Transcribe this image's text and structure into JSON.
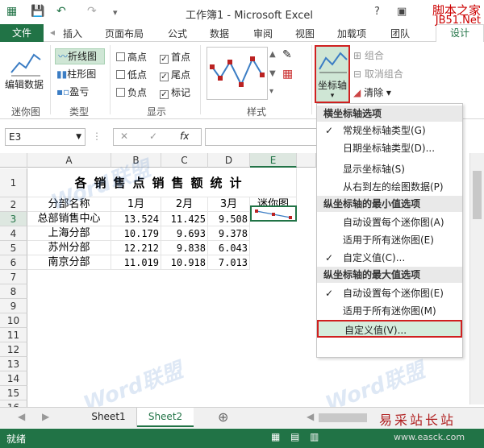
{
  "titlebar": {
    "title": "工作簿1 - Microsoft Excel",
    "help": "?",
    "brand_top": "脚本之家",
    "brand_bottom": "JB51.Net"
  },
  "tabs": [
    "插入",
    "页面布局",
    "公式",
    "数据",
    "审阅",
    "视图",
    "加载项",
    "团队"
  ],
  "file_tab": "文件",
  "design_tab": "设计",
  "ribbon": {
    "sparkline_group": {
      "edit_label": "编辑数据",
      "group_label": "迷你图"
    },
    "type_group": {
      "line": "折线图",
      "column": "柱形图",
      "winloss": "盈亏",
      "group_label": "类型"
    },
    "show_group": {
      "high": "高点",
      "first": "首点",
      "low": "低点",
      "last": "尾点",
      "negative": "负点",
      "markers": "标记",
      "high_checked": false,
      "first_checked": true,
      "low_checked": false,
      "last_checked": true,
      "negative_checked": false,
      "markers_checked": true,
      "group_label": "显示"
    },
    "style_group": {
      "group_label": "样式"
    },
    "axis_button": "坐标轴",
    "group_btn": "组合",
    "ungroup_btn": "取消组合",
    "clear_btn": "清除"
  },
  "formula": {
    "namebox": "E3",
    "fx": "fx"
  },
  "columns": [
    "A",
    "B",
    "C",
    "D",
    "E"
  ],
  "rows": [
    "1",
    "2",
    "3",
    "4",
    "5",
    "6",
    "7",
    "8",
    "9",
    "10",
    "11",
    "12",
    "13",
    "14",
    "15",
    "16"
  ],
  "sheet": {
    "title": "各销售点销售额统计",
    "headers": [
      "分部名称",
      "1月",
      "2月",
      "3月",
      "迷你图"
    ],
    "data": [
      {
        "name": "总部销售中心",
        "m1": "13.524",
        "m2": "11.425",
        "m3": "9.508"
      },
      {
        "name": "上海分部",
        "m1": "10.179",
        "m2": "9.693",
        "m3": "9.378"
      },
      {
        "name": "苏州分部",
        "m1": "12.212",
        "m2": "9.838",
        "m3": "6.043"
      },
      {
        "name": "南京分部",
        "m1": "11.019",
        "m2": "10.918",
        "m3": "7.013"
      }
    ]
  },
  "dropdown": {
    "h_axis_header": "横坐标轴选项",
    "h_items": [
      {
        "label": "常规坐标轴类型(G)",
        "checked": true
      },
      {
        "label": "日期坐标轴类型(D)...",
        "checked": false
      },
      {
        "label": "显示坐标轴(S)",
        "checked": false
      },
      {
        "label": "从右到左的绘图数据(P)",
        "checked": false
      }
    ],
    "v_min_header": "纵坐标轴的最小值选项",
    "v_min_items": [
      {
        "label": "自动设置每个迷你图(A)",
        "checked": false
      },
      {
        "label": "适用于所有迷你图(E)",
        "checked": false
      },
      {
        "label": "自定义值(C)...",
        "checked": true
      }
    ],
    "v_max_header": "纵坐标轴的最大值选项",
    "v_max_items": [
      {
        "label": "自动设置每个迷你图(E)",
        "checked": true
      },
      {
        "label": "适用于所有迷你图(M)",
        "checked": false
      },
      {
        "label": "自定义值(V)...",
        "checked": false
      }
    ]
  },
  "sheet_tabs": [
    "Sheet1",
    "Sheet2"
  ],
  "status": {
    "ready": "就绪"
  },
  "watermark": "Word联盟",
  "bottom_brand": "易采站长站",
  "bottom_url": "www.easck.com"
}
